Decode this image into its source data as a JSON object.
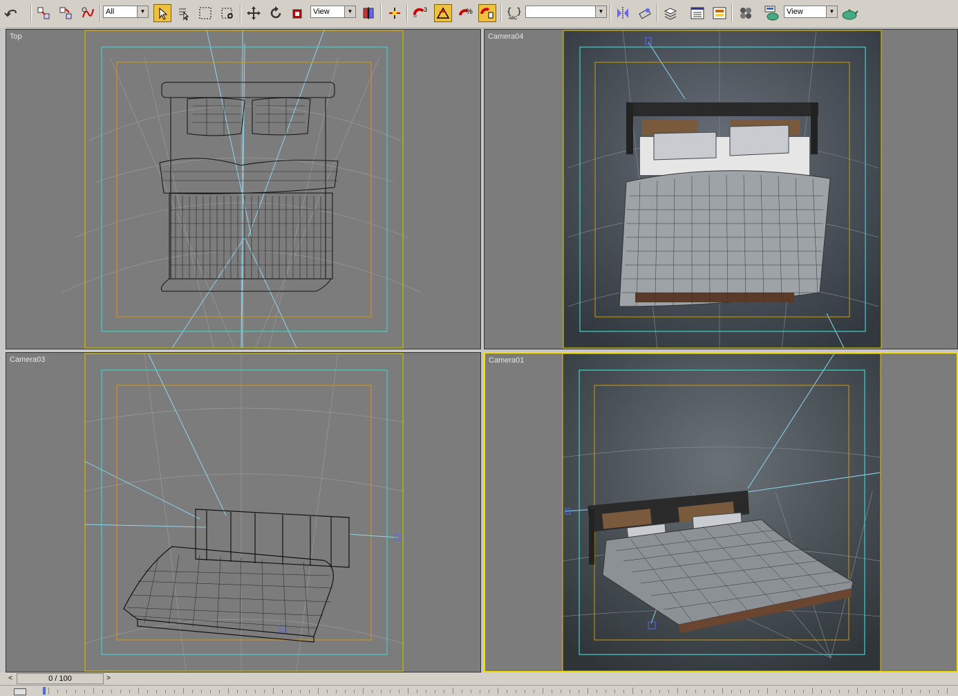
{
  "toolbar": {
    "selection_filter": "All",
    "ref_coord_1": "View",
    "named_selection": "",
    "ref_coord_2": "View",
    "snap_angle": "3",
    "icons": [
      "undo-icon",
      "redo-icon",
      "link-icon",
      "unlink-icon",
      "bind-spacewarp-icon",
      "select-object-icon",
      "select-by-name-icon",
      "rectangular-selection-icon",
      "window-crossing-icon",
      "move-icon",
      "rotate-icon",
      "scale-icon",
      "mirror-icon",
      "manipulate-icon",
      "snap-3d-icon",
      "angle-snap-icon",
      "percent-snap-icon",
      "spinner-snap-icon",
      "edit-named-selection-icon",
      "align-icon",
      "layer-icon",
      "curve-editor-icon",
      "schematic-view-icon",
      "material-editor-icon",
      "render-setup-icon",
      "render-icon",
      "quick-render-icon"
    ]
  },
  "viewports": {
    "top": {
      "label": "Top"
    },
    "camera04": {
      "label": "Camera04"
    },
    "camera03": {
      "label": "Camera03"
    },
    "camera01": {
      "label": "Camera01"
    }
  },
  "timeline": {
    "frame": "0 / 100",
    "prev": "<",
    "next": ">"
  },
  "colors": {
    "safe_frame_outer": "#d4b400",
    "safe_frame_action": "#40d0d0",
    "safe_frame_title": "#d49a00",
    "active_viewport": "#f0e000",
    "viewport_bg": "#7c7c7c"
  }
}
